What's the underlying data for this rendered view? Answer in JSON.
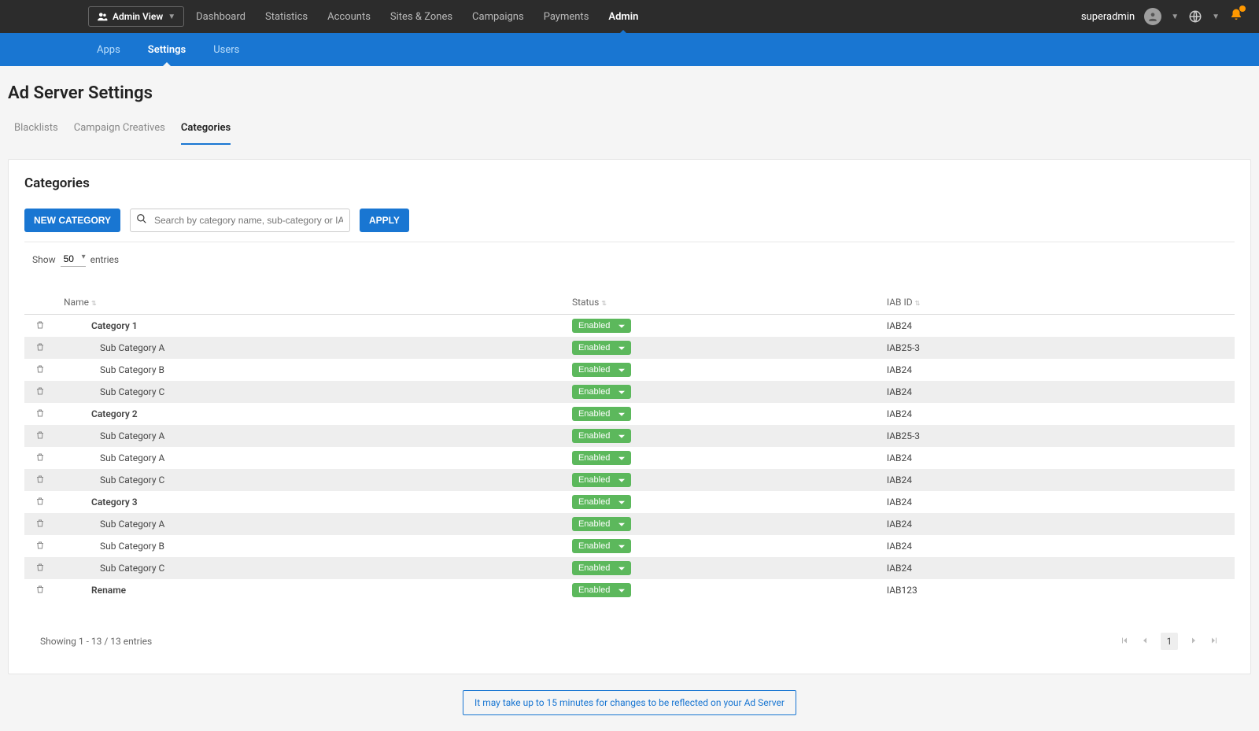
{
  "topbar": {
    "view_switch": "Admin View",
    "nav": [
      "Dashboard",
      "Statistics",
      "Accounts",
      "Sites & Zones",
      "Campaigns",
      "Payments",
      "Admin"
    ],
    "active_nav": 6,
    "user": "superadmin"
  },
  "subbar": {
    "items": [
      "Apps",
      "Settings",
      "Users"
    ],
    "active": 1
  },
  "page": {
    "title": "Ad Server Settings",
    "tabs": [
      "Blacklists",
      "Campaign Creatives",
      "Categories"
    ],
    "active_tab": 2
  },
  "card": {
    "heading": "Categories",
    "new_button": "NEW CATEGORY",
    "search_placeholder": "Search by category name, sub-category or IAB ID",
    "apply_button": "APPLY",
    "entries": {
      "show_label": "Show",
      "value": "50",
      "entries_label": "entries"
    },
    "columns": {
      "name": "Name",
      "status": "Status",
      "iab": "IAB ID"
    },
    "status_option": "Enabled",
    "rows": [
      {
        "name": "Category 1",
        "indent": false,
        "shade": false,
        "iab": "IAB24"
      },
      {
        "name": "Sub Category A",
        "indent": true,
        "shade": true,
        "iab": "IAB25-3"
      },
      {
        "name": "Sub Category B",
        "indent": true,
        "shade": false,
        "iab": "IAB24"
      },
      {
        "name": "Sub Category C",
        "indent": true,
        "shade": true,
        "iab": "IAB24"
      },
      {
        "name": "Category 2",
        "indent": false,
        "shade": false,
        "iab": "IAB24"
      },
      {
        "name": "Sub Category A",
        "indent": true,
        "shade": true,
        "iab": "IAB25-3"
      },
      {
        "name": "Sub Category A",
        "indent": true,
        "shade": false,
        "iab": "IAB24"
      },
      {
        "name": "Sub Category C",
        "indent": true,
        "shade": true,
        "iab": "IAB24"
      },
      {
        "name": "Category 3",
        "indent": false,
        "shade": false,
        "iab": "IAB24"
      },
      {
        "name": "Sub Category A",
        "indent": true,
        "shade": true,
        "iab": "IAB24"
      },
      {
        "name": "Sub Category B",
        "indent": true,
        "shade": false,
        "iab": "IAB24"
      },
      {
        "name": "Sub Category C",
        "indent": true,
        "shade": true,
        "iab": "IAB24"
      },
      {
        "name": "Rename",
        "indent": false,
        "shade": false,
        "iab": "IAB123"
      }
    ],
    "footer_text": "Showing 1 - 13 / 13 entries",
    "pager_current": "1"
  },
  "notice": "It may take up to 15 minutes for changes to be reflected on your Ad Server"
}
